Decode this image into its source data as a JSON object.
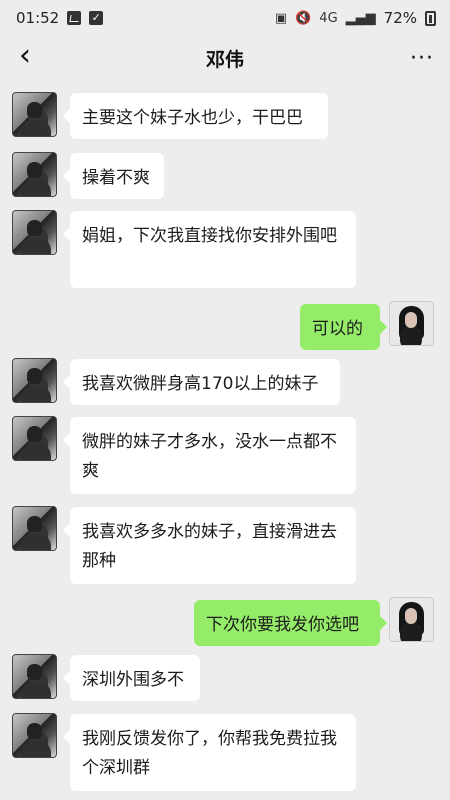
{
  "status_bar": {
    "time": "01:52",
    "network": "4G",
    "battery": "72%",
    "icons": [
      "image-icon",
      "check-square-icon",
      "notification-icon",
      "mute-icon",
      "signal-icon",
      "battery-icon"
    ]
  },
  "header": {
    "back_icon": "back-arrow-icon",
    "title": "邓伟",
    "more_icon": "more-icon"
  },
  "messages": [
    {
      "side": "left",
      "text": "主要这个妹子水也少，干巴巴"
    },
    {
      "side": "left",
      "text": "操着不爽"
    },
    {
      "side": "left",
      "text": "娟姐，下次我直接找你安排外围吧"
    },
    {
      "side": "right",
      "text": "可以的"
    },
    {
      "side": "left",
      "text": "我喜欢微胖身高170以上的妹子"
    },
    {
      "side": "left",
      "text": "微胖的妹子才多水，没水一点都不爽"
    },
    {
      "side": "left",
      "text": "我喜欢多多水的妹子，直接滑进去那种"
    },
    {
      "side": "right",
      "text": "下次你要我发你选吧"
    },
    {
      "side": "left",
      "text": "深圳外围多不"
    },
    {
      "side": "left",
      "text": "我刚反馈发你了，你帮我免费拉我个深圳群"
    }
  ],
  "colors": {
    "background": "#ededed",
    "incoming_bubble": "#ffffff",
    "outgoing_bubble": "#95ec69"
  }
}
